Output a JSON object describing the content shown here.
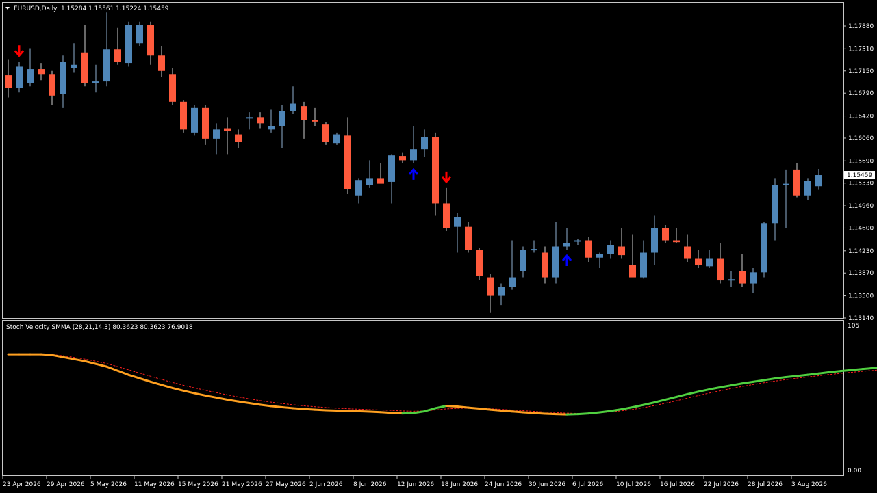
{
  "window": {
    "symbol_title": "EURUSD,Daily",
    "ohlc": "1.15284 1.15561 1.15224 1.15459"
  },
  "indicator": {
    "title": "Stoch Velocity SMMA (28,21,14,3) 80.3623 80.3623 76.9018",
    "scale_top": "105",
    "scale_bottom": "0.00"
  },
  "price_axis": {
    "labels": [
      "1.17880",
      "1.17510",
      "1.17150",
      "1.16790",
      "1.16420",
      "1.16060",
      "1.15690",
      "1.15330",
      "1.14960",
      "1.14600",
      "1.14230",
      "1.13870",
      "1.13500",
      "1.13140"
    ],
    "current_price_label": "1.15459"
  },
  "time_axis": {
    "labels": [
      "23 Apr 2026",
      "29 Apr 2026",
      "5 May 2026",
      "11 May 2026",
      "15 May 2026",
      "21 May 2026",
      "27 May 2026",
      "2 Jun 2026",
      "8 Jun 2026",
      "12 Jun 2026",
      "18 Jun 2026",
      "24 Jun 2026",
      "30 Jun 2026",
      "6 Jul 2026",
      "10 Jul 2026",
      "16 Jul 2026",
      "22 Jul 2026",
      "28 Jul 2026",
      "3 Aug 2026"
    ]
  },
  "colors": {
    "bull": "#4f86b8",
    "bear": "#ff5a3c",
    "wick_bull": "#8fb0d0",
    "wick_bear": "#d0d0d0",
    "frame": "#c8c8c8",
    "arrow_down": "#ff0000",
    "arrow_up": "#0000ff",
    "osc_falling": "#ffa020",
    "osc_rising": "#50d040",
    "signal": "#ff2020"
  },
  "chart_data": {
    "type": "candlestick",
    "symbol": "EURUSD",
    "timeframe": "Daily",
    "ylim": [
      1.1314,
      1.1808
    ],
    "candles": [
      {
        "o": 1.1708,
        "h": 1.1733,
        "l": 1.1672,
        "c": 1.1688
      },
      {
        "o": 1.1688,
        "h": 1.173,
        "l": 1.168,
        "c": 1.1722
      },
      {
        "o": 1.1695,
        "h": 1.1752,
        "l": 1.169,
        "c": 1.1718
      },
      {
        "o": 1.1718,
        "h": 1.1728,
        "l": 1.17,
        "c": 1.171
      },
      {
        "o": 1.171,
        "h": 1.1715,
        "l": 1.166,
        "c": 1.1675
      },
      {
        "o": 1.1678,
        "h": 1.174,
        "l": 1.1655,
        "c": 1.173
      },
      {
        "o": 1.172,
        "h": 1.176,
        "l": 1.1712,
        "c": 1.1725
      },
      {
        "o": 1.1745,
        "h": 1.179,
        "l": 1.169,
        "c": 1.1695
      },
      {
        "o": 1.1695,
        "h": 1.1725,
        "l": 1.168,
        "c": 1.1698
      },
      {
        "o": 1.1698,
        "h": 1.181,
        "l": 1.169,
        "c": 1.175
      },
      {
        "o": 1.175,
        "h": 1.1785,
        "l": 1.1725,
        "c": 1.173
      },
      {
        "o": 1.1728,
        "h": 1.1795,
        "l": 1.1722,
        "c": 1.179
      },
      {
        "o": 1.176,
        "h": 1.1795,
        "l": 1.1755,
        "c": 1.179
      },
      {
        "o": 1.179,
        "h": 1.1795,
        "l": 1.1725,
        "c": 1.174
      },
      {
        "o": 1.174,
        "h": 1.1755,
        "l": 1.1705,
        "c": 1.1715
      },
      {
        "o": 1.171,
        "h": 1.172,
        "l": 1.166,
        "c": 1.1665
      },
      {
        "o": 1.1665,
        "h": 1.1668,
        "l": 1.1615,
        "c": 1.162
      },
      {
        "o": 1.1615,
        "h": 1.166,
        "l": 1.161,
        "c": 1.1655
      },
      {
        "o": 1.1655,
        "h": 1.166,
        "l": 1.1595,
        "c": 1.1605
      },
      {
        "o": 1.1605,
        "h": 1.163,
        "l": 1.158,
        "c": 1.162
      },
      {
        "o": 1.1622,
        "h": 1.164,
        "l": 1.158,
        "c": 1.1618
      },
      {
        "o": 1.1612,
        "h": 1.162,
        "l": 1.159,
        "c": 1.16
      },
      {
        "o": 1.1638,
        "h": 1.1648,
        "l": 1.162,
        "c": 1.164
      },
      {
        "o": 1.164,
        "h": 1.1648,
        "l": 1.1622,
        "c": 1.163
      },
      {
        "o": 1.162,
        "h": 1.1652,
        "l": 1.1615,
        "c": 1.1625
      },
      {
        "o": 1.1625,
        "h": 1.166,
        "l": 1.159,
        "c": 1.165
      },
      {
        "o": 1.165,
        "h": 1.169,
        "l": 1.1645,
        "c": 1.1662
      },
      {
        "o": 1.1658,
        "h": 1.1665,
        "l": 1.1605,
        "c": 1.1635
      },
      {
        "o": 1.1635,
        "h": 1.1655,
        "l": 1.1625,
        "c": 1.1633
      },
      {
        "o": 1.1628,
        "h": 1.1632,
        "l": 1.1595,
        "c": 1.16
      },
      {
        "o": 1.1598,
        "h": 1.1615,
        "l": 1.1595,
        "c": 1.1612
      },
      {
        "o": 1.161,
        "h": 1.164,
        "l": 1.1515,
        "c": 1.1523
      },
      {
        "o": 1.1513,
        "h": 1.154,
        "l": 1.15,
        "c": 1.1538
      },
      {
        "o": 1.153,
        "h": 1.157,
        "l": 1.1525,
        "c": 1.154
      },
      {
        "o": 1.154,
        "h": 1.1565,
        "l": 1.1533,
        "c": 1.1532
      },
      {
        "o": 1.1535,
        "h": 1.158,
        "l": 1.15,
        "c": 1.1578
      },
      {
        "o": 1.1577,
        "h": 1.1582,
        "l": 1.1565,
        "c": 1.157
      },
      {
        "o": 1.157,
        "h": 1.1625,
        "l": 1.1565,
        "c": 1.1588
      },
      {
        "o": 1.1588,
        "h": 1.162,
        "l": 1.1575,
        "c": 1.1608
      },
      {
        "o": 1.1608,
        "h": 1.1615,
        "l": 1.148,
        "c": 1.15
      },
      {
        "o": 1.15,
        "h": 1.1525,
        "l": 1.1455,
        "c": 1.146
      },
      {
        "o": 1.1462,
        "h": 1.1485,
        "l": 1.142,
        "c": 1.1478
      },
      {
        "o": 1.1462,
        "h": 1.147,
        "l": 1.142,
        "c": 1.1425
      },
      {
        "o": 1.1425,
        "h": 1.1428,
        "l": 1.1375,
        "c": 1.1382
      },
      {
        "o": 1.138,
        "h": 1.1385,
        "l": 1.1322,
        "c": 1.135
      },
      {
        "o": 1.135,
        "h": 1.137,
        "l": 1.1335,
        "c": 1.1365
      },
      {
        "o": 1.1365,
        "h": 1.144,
        "l": 1.136,
        "c": 1.138
      },
      {
        "o": 1.139,
        "h": 1.143,
        "l": 1.138,
        "c": 1.1425
      },
      {
        "o": 1.1425,
        "h": 1.144,
        "l": 1.142,
        "c": 1.1426
      },
      {
        "o": 1.142,
        "h": 1.143,
        "l": 1.137,
        "c": 1.138
      },
      {
        "o": 1.138,
        "h": 1.147,
        "l": 1.137,
        "c": 1.143
      },
      {
        "o": 1.143,
        "h": 1.146,
        "l": 1.1425,
        "c": 1.1435
      },
      {
        "o": 1.1438,
        "h": 1.1442,
        "l": 1.1432,
        "c": 1.144
      },
      {
        "o": 1.144,
        "h": 1.1445,
        "l": 1.1405,
        "c": 1.1412
      },
      {
        "o": 1.1412,
        "h": 1.142,
        "l": 1.1395,
        "c": 1.1418
      },
      {
        "o": 1.1418,
        "h": 1.144,
        "l": 1.141,
        "c": 1.1432
      },
      {
        "o": 1.143,
        "h": 1.146,
        "l": 1.141,
        "c": 1.1416
      },
      {
        "o": 1.14,
        "h": 1.145,
        "l": 1.138,
        "c": 1.138
      },
      {
        "o": 1.138,
        "h": 1.144,
        "l": 1.1378,
        "c": 1.142
      },
      {
        "o": 1.142,
        "h": 1.148,
        "l": 1.14,
        "c": 1.146
      },
      {
        "o": 1.146,
        "h": 1.1465,
        "l": 1.1435,
        "c": 1.144
      },
      {
        "o": 1.144,
        "h": 1.146,
        "l": 1.1435,
        "c": 1.1437
      },
      {
        "o": 1.143,
        "h": 1.145,
        "l": 1.1405,
        "c": 1.141
      },
      {
        "o": 1.141,
        "h": 1.1425,
        "l": 1.1395,
        "c": 1.14
      },
      {
        "o": 1.1398,
        "h": 1.1425,
        "l": 1.1395,
        "c": 1.141
      },
      {
        "o": 1.141,
        "h": 1.1435,
        "l": 1.137,
        "c": 1.1375
      },
      {
        "o": 1.1375,
        "h": 1.139,
        "l": 1.1365,
        "c": 1.1377
      },
      {
        "o": 1.139,
        "h": 1.1418,
        "l": 1.1365,
        "c": 1.137
      },
      {
        "o": 1.137,
        "h": 1.1395,
        "l": 1.1355,
        "c": 1.1388
      },
      {
        "o": 1.1388,
        "h": 1.147,
        "l": 1.138,
        "c": 1.1468
      },
      {
        "o": 1.1468,
        "h": 1.154,
        "l": 1.144,
        "c": 1.153
      },
      {
        "o": 1.153,
        "h": 1.1555,
        "l": 1.146,
        "c": 1.1532
      },
      {
        "o": 1.1555,
        "h": 1.1565,
        "l": 1.151,
        "c": 1.1513
      },
      {
        "o": 1.1513,
        "h": 1.154,
        "l": 1.1505,
        "c": 1.1537
      },
      {
        "o": 1.1528,
        "h": 1.1556,
        "l": 1.1522,
        "c": 1.1546
      }
    ],
    "signals": [
      {
        "index": 1,
        "type": "down"
      },
      {
        "index": 37,
        "type": "up"
      },
      {
        "index": 40,
        "type": "down"
      },
      {
        "index": 51,
        "type": "up"
      }
    ],
    "oscillator": {
      "name": "Stoch Velocity SMMA (28,21,14,3)",
      "ylim": [
        0,
        105
      ],
      "main": [
        88,
        88,
        88,
        88,
        87.5,
        86,
        84.5,
        83,
        81,
        79,
        76,
        73,
        70.5,
        68,
        65.7,
        63.5,
        61.5,
        59.7,
        58,
        56.5,
        55,
        53.7,
        52.5,
        51.3,
        50.3,
        49.5,
        48.8,
        48.2,
        47.7,
        47.3,
        47,
        46.8,
        46.6,
        46.3,
        45.9,
        45.4,
        45,
        45.3,
        46.5,
        48.8,
        50.5,
        50,
        49.2,
        48.5,
        47.7,
        47,
        46.4,
        45.8,
        45.3,
        44.8,
        44.5,
        44.2,
        44.5,
        45,
        45.8,
        46.8,
        48,
        49.5,
        51.2,
        53,
        55,
        57,
        59,
        60.8,
        62.5,
        64,
        65.4,
        66.8,
        68,
        69.2,
        70.4,
        71.4,
        72.2,
        73.1,
        74,
        75,
        75.8,
        76.6,
        77.3,
        78,
        78.6,
        79.2,
        79.7,
        80.2
      ],
      "signal": [
        88,
        88,
        88,
        88,
        87.8,
        87,
        85.8,
        84.5,
        83,
        81.3,
        79,
        76.7,
        74.3,
        72,
        69.7,
        67.5,
        65.5,
        63.6,
        61.8,
        60.1,
        58.5,
        57,
        55.6,
        54.3,
        53.2,
        52.2,
        51.3,
        50.5,
        49.9,
        49.3,
        48.8,
        48.4,
        48.1,
        47.8,
        47.5,
        47.2,
        46.8,
        46.6,
        46.8,
        47.5,
        48.3,
        48.7,
        48.8,
        48.7,
        48.4,
        48,
        47.5,
        47,
        46.5,
        46,
        45.6,
        45.2,
        45,
        45.1,
        45.5,
        46.1,
        46.9,
        47.9,
        49.2,
        50.7,
        52.4,
        54.2,
        56.1,
        58,
        59.8,
        61.5,
        63.1,
        64.6,
        66,
        67.3,
        68.5,
        69.6,
        70.6,
        71.5,
        72.4,
        73.3,
        74.1,
        74.9,
        75.6,
        76.3,
        76.9
      ]
    }
  }
}
